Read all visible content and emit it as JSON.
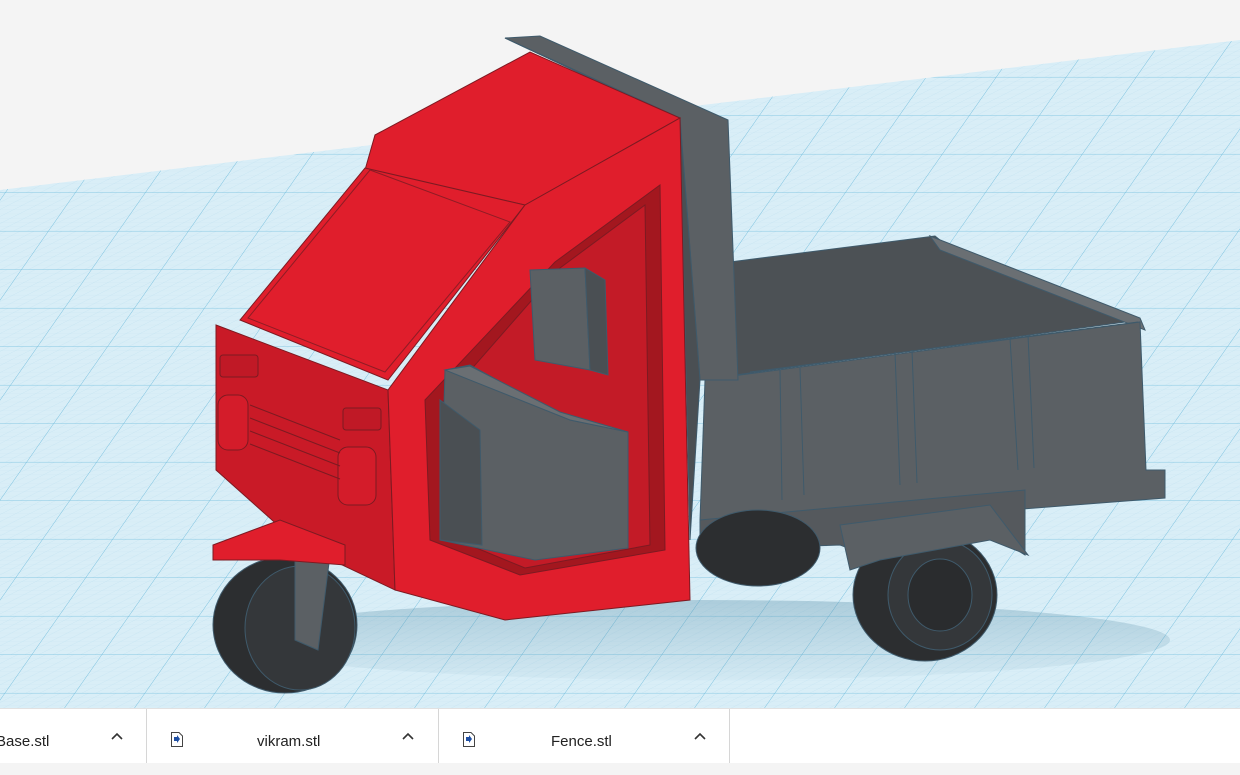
{
  "viewport": {
    "scene": "3D model workplane",
    "grid_color": "#cfe8f3",
    "grid_line_color": "#7ec4e0",
    "model_colors": {
      "cab_red": "#e01e2c",
      "body_gray": "#5b6064",
      "tire_black": "#2c2e30"
    }
  },
  "downloads": {
    "items": [
      {
        "name": "Base.stl",
        "icon": "file-icon",
        "menu_icon": "chevron-up-icon"
      },
      {
        "name": "vikram.stl",
        "icon": "file-icon",
        "menu_icon": "chevron-up-icon"
      },
      {
        "name": "Fence.stl",
        "icon": "file-icon",
        "menu_icon": "chevron-up-icon"
      }
    ]
  }
}
